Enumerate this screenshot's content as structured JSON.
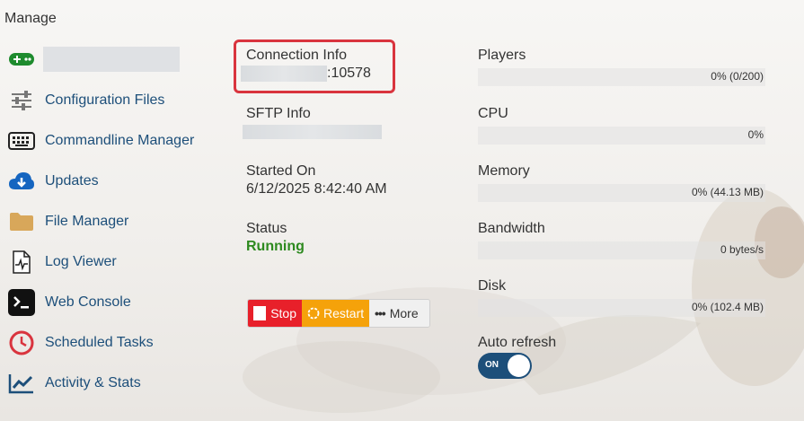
{
  "page": {
    "title": "Manage"
  },
  "sidebar": {
    "items": [
      {
        "label": "",
        "icon": "gamepad-icon",
        "color": "#1e8b2e"
      },
      {
        "label": "Configuration Files",
        "icon": "sliders-icon"
      },
      {
        "label": "Commandline Manager",
        "icon": "keyboard-icon"
      },
      {
        "label": "Updates",
        "icon": "cloud-download-icon",
        "color": "#1565c0"
      },
      {
        "label": "File Manager",
        "icon": "folder-icon",
        "color": "#d8a75a"
      },
      {
        "label": "Log Viewer",
        "icon": "log-file-icon"
      },
      {
        "label": "Web Console",
        "icon": "terminal-icon"
      },
      {
        "label": "Scheduled Tasks",
        "icon": "clock-icon",
        "color": "#d9343e"
      },
      {
        "label": "Activity & Stats",
        "icon": "chart-line-icon",
        "color": "#1d4f7a"
      }
    ]
  },
  "info": {
    "connection_label": "Connection Info",
    "connection_port": ":10578",
    "sftp_label": "SFTP Info",
    "started_label": "Started On",
    "started_value": "6/12/2025 8:42:40 AM",
    "status_label": "Status",
    "status_value": "Running",
    "status_color": "#2d8a1f"
  },
  "actions": {
    "stop_label": "Stop",
    "restart_label": "Restart",
    "more_label": "More"
  },
  "metrics": [
    {
      "label": "Players",
      "value_text": "0% (0/200)",
      "fraction": 0
    },
    {
      "label": "CPU",
      "value_text": "0%",
      "fraction": 0
    },
    {
      "label": "Memory",
      "value_text": "0% (44.13 MB)",
      "fraction": 0
    },
    {
      "label": "Bandwidth",
      "value_text": "0 bytes/s",
      "fraction": 0
    },
    {
      "label": "Disk",
      "value_text": "0% (102.4 MB)",
      "fraction": 0
    }
  ],
  "auto_refresh": {
    "label": "Auto refresh",
    "state_label": "ON",
    "enabled": true
  }
}
